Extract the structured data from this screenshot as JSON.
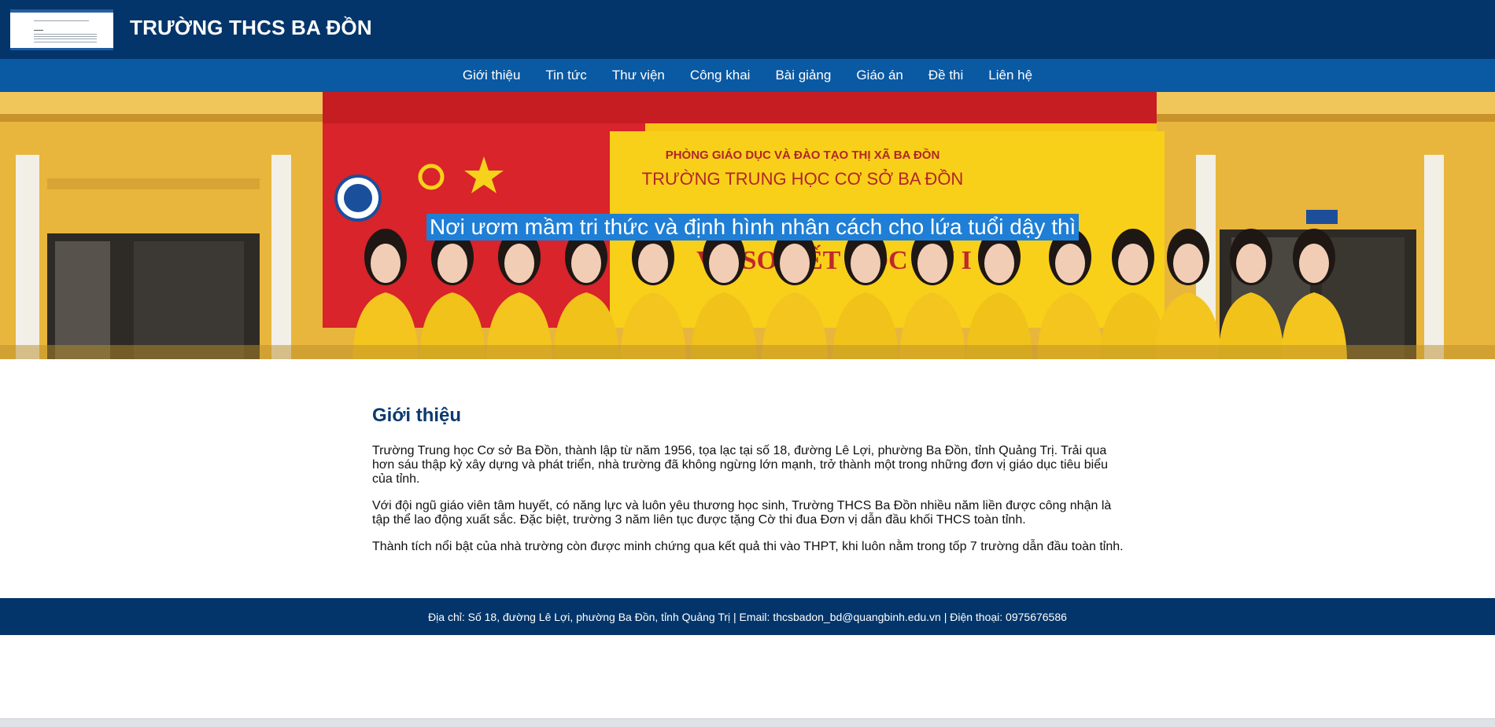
{
  "header": {
    "title": "TRƯỜNG THCS BA ĐỒN",
    "logo_icon": "school-logo-thumbnail"
  },
  "nav": {
    "items": [
      {
        "label": "Giới thiệu"
      },
      {
        "label": "Tin tức"
      },
      {
        "label": "Thư viện"
      },
      {
        "label": "Công khai"
      },
      {
        "label": "Bài giảng"
      },
      {
        "label": "Giáo án"
      },
      {
        "label": "Đề thi"
      },
      {
        "label": "Liên hệ"
      }
    ]
  },
  "hero": {
    "tagline": "Nơi ươm mầm tri thức và định hình nhân cách cho lứa tuổi dậy thì",
    "banner_line_1": "PHÒNG GIÁO DỤC VÀ ĐÀO TẠO THỊ XÃ BA ĐỒN",
    "banner_line_2": "TRƯỜNG TRUNG HỌC CƠ SỞ BA ĐỒN",
    "banner_line_3": "VÀ SƠ KẾT HỌC KỲ I"
  },
  "intro": {
    "title": "Giới thiệu",
    "paragraphs": [
      "Trường Trung học Cơ sở Ba Đồn, thành lập từ năm 1956, tọa lạc tại số 18, đường Lê Lợi, phường Ba Đồn, tỉnh Quảng Trị. Trải qua hơn sáu thập kỷ xây dựng và phát triển, nhà trường đã không ngừng lớn mạnh, trở thành một trong những đơn vị giáo dục tiêu biểu của tỉnh.",
      "Với đội ngũ giáo viên tâm huyết, có năng lực và luôn yêu thương học sinh, Trường THCS Ba Đồn nhiều năm liền được công nhận là tập thể lao động xuất sắc. Đặc biệt, trường 3 năm liên tục được tặng Cờ thi đua Đơn vị dẫn đầu khối THCS toàn tỉnh.",
      "Thành tích nổi bật của nhà trường còn được minh chứng qua kết quả thi vào THPT, khi luôn nằm trong tốp 7 trường dẫn đầu toàn tỉnh."
    ]
  },
  "footer": {
    "text": "Địa chỉ: Số 18, đường Lê Lợi, phường Ba Đồn, tỉnh Quảng Trị | Email: thcsbadon_bd@quangbinh.edu.vn | Điện thoại: 0975676586"
  },
  "colors": {
    "header_bg": "#03356a",
    "nav_bg": "#0a59a3",
    "title_blue": "#0b3a70",
    "tagline_bg": "#1f7fd6"
  }
}
